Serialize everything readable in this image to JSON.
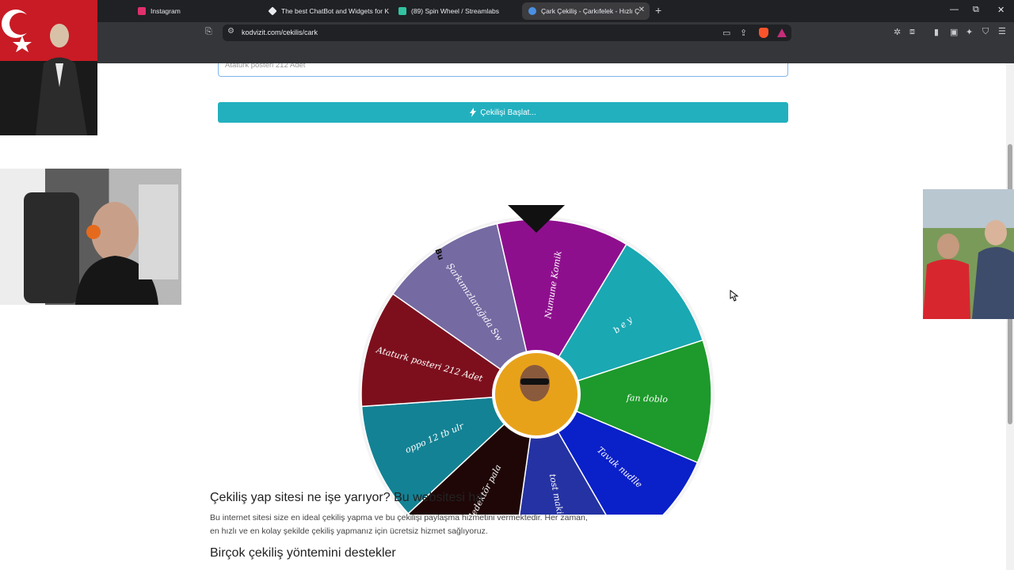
{
  "browser": {
    "tabs": [
      {
        "title": "Instagram",
        "favicon_color": "#e1306c"
      },
      {
        "title": "The best ChatBot and Widgets for Ki",
        "favicon_color": "#e8eaed"
      },
      {
        "title": "(89) Spin Wheel / Streamlabs",
        "favicon_color": "#31c3a2"
      },
      {
        "title": "Çark Çekiliş - Çarkıfelek - Hızlı Ç",
        "favicon_color": "#4a90e2"
      }
    ],
    "active_tab": 3,
    "new_tab_label": "+",
    "url": "kodvizit.com/cekilis/cark",
    "win_controls": {
      "minimize": "—",
      "maximize": "⧉",
      "close": "✕"
    }
  },
  "page": {
    "textarea_value": "Ataturk posteri 212 Adet",
    "start_button_icon": "lightning-bolt-icon",
    "start_button": "Çekilişi Başlat...",
    "heading1": "Çekiliş yap sitesi ne işe yarıyor? Bu websitesi ha",
    "paragraph1": "Bu internet sitesi size en ideal çekiliş yapma ve bu çekilişi paylaşma hizmetini vermektedir. Her zaman, en hızlı ve en kolay şekilde çekiliş yapmanız için ücretsiz hizmet sağlıyoruz.",
    "heading2": "Birçok çekiliş yöntemini destekler"
  },
  "wheel": {
    "pointer_color": "#111111",
    "segments": [
      {
        "label": "Numune Komik",
        "color": "#8e0f8e"
      },
      {
        "label": "b e y",
        "color": "#1aa8b3"
      },
      {
        "label": "fan doblo",
        "color": "#1d9a2b"
      },
      {
        "label": "Tavuk nudlle",
        "color": "#0a20c9"
      },
      {
        "label": "tost makinası",
        "color": "#2532a3"
      },
      {
        "label": "dedektör pala",
        "color": "#1f0707"
      },
      {
        "label": "oppo 12 tb ulr",
        "color": "#138294"
      },
      {
        "label": "Ataturk posteri 212 Adet",
        "color": "#7d0f1d"
      },
      {
        "label": "Şarkımızlarağıda Sw",
        "color": "#756aa2"
      }
    ],
    "edge_label": "Bu"
  }
}
